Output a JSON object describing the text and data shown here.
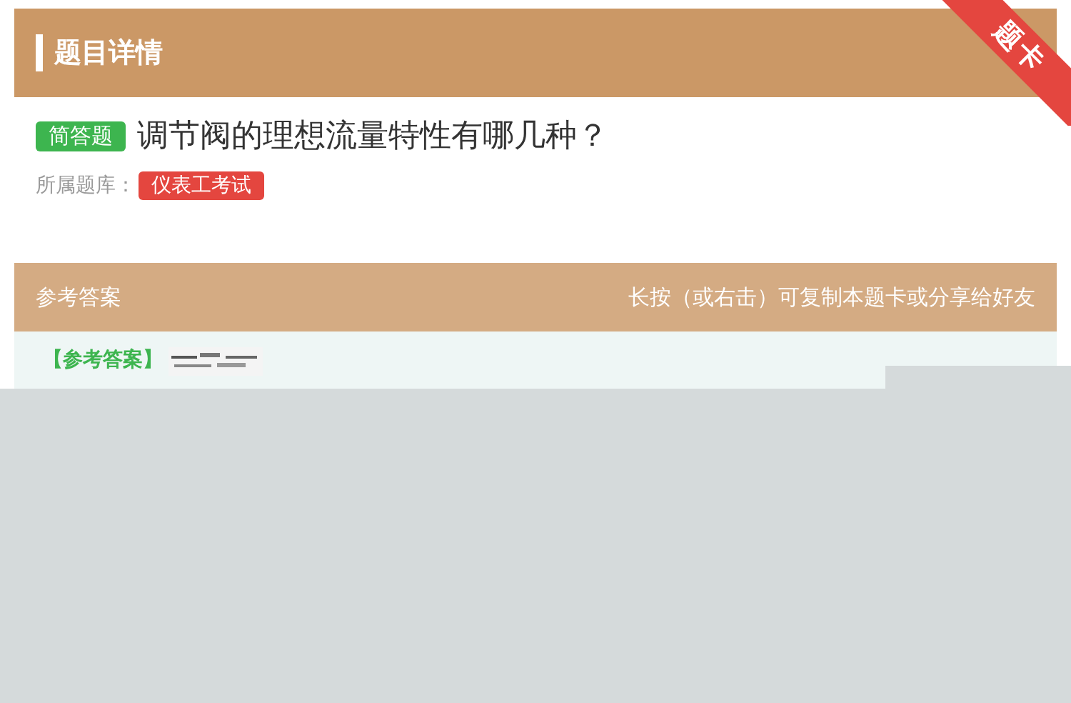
{
  "header": {
    "title": "题目详情",
    "ribbon": "题卡"
  },
  "question": {
    "type_badge": "简答题",
    "text": "调节阀的理想流量特性有哪几种？",
    "bank_label": "所属题库：",
    "bank": "仪表工考试"
  },
  "answer": {
    "title": "参考答案",
    "hint": "长按（或右击）可复制本题卡或分享给好友",
    "label": "【参考答案】"
  }
}
